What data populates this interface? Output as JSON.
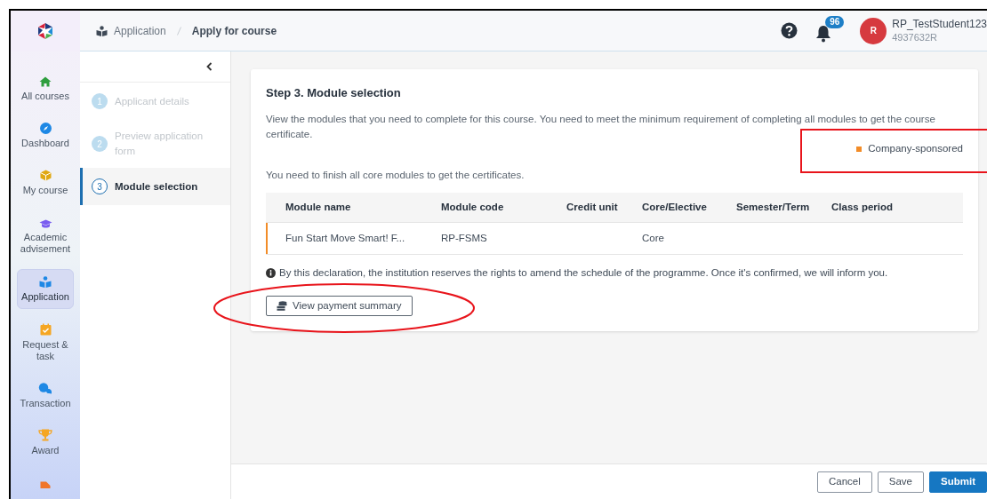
{
  "header": {
    "breadcrumbs": [
      {
        "label": "Application",
        "selected": false
      },
      {
        "label": "Apply for course",
        "selected": true
      }
    ],
    "notifications": "96",
    "user": {
      "initial": "R",
      "name": "RP_TestStudent123",
      "id": "4937632R"
    }
  },
  "sidebar": {
    "items": [
      {
        "label": "All courses",
        "selected": false
      },
      {
        "label": "Dashboard",
        "selected": false
      },
      {
        "label": "My course",
        "selected": false
      },
      {
        "label": "Academic advisement",
        "selected": false
      },
      {
        "label": "Application",
        "selected": true
      },
      {
        "label": "Request & task",
        "selected": false
      },
      {
        "label": "Transaction",
        "selected": false
      },
      {
        "label": "Award",
        "selected": false
      },
      {
        "selected": false
      }
    ]
  },
  "steps": [
    {
      "number": "1",
      "label": "Applicant details",
      "selected": false
    },
    {
      "number": "2",
      "label": "Preview application form",
      "selected": false
    },
    {
      "number": "3",
      "label": "Module selection",
      "selected": true
    }
  ],
  "card": {
    "title": "Step 3. Module selection",
    "intro": "View the modules that you need to complete for this course. You need to meet the minimum requirement of completing all modules to get the course certificate.",
    "legend": {
      "label": "Company-sponsored",
      "color": "#f28c28"
    },
    "note": "You need to finish all core modules to get the certificates.",
    "table": {
      "columns": [
        "Module name",
        "Module code",
        "Credit unit",
        "Core/Elective",
        "Semester/Term",
        "Class period"
      ],
      "rows": [
        {
          "cells": [
            "Fun Start Move Smart! F...",
            "RP-FSMS",
            "",
            "Core",
            "",
            ""
          ],
          "color": "#f28c28"
        }
      ]
    },
    "declaration": "By this declaration, the institution reserves the rights to amend the schedule of the programme. Once it's confirmed, we will inform you.",
    "payment_button": "View payment summary"
  },
  "footer": {
    "buttons": [
      {
        "label": "Cancel",
        "kind": "secondary"
      },
      {
        "label": "Save",
        "kind": "secondary"
      },
      {
        "label": "Submit",
        "kind": "primary"
      }
    ]
  }
}
